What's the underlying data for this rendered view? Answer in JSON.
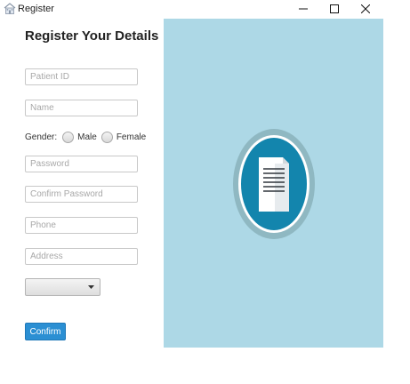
{
  "window": {
    "title": "Register",
    "icon": "hospital-icon",
    "controls": [
      "minimize-icon",
      "maximize-icon",
      "close-icon"
    ]
  },
  "form": {
    "heading": "Register Your Details",
    "patient_id_placeholder": "Patient ID",
    "name_placeholder": "Name",
    "gender": {
      "label": "Gender:",
      "options": [
        "Male",
        "Female"
      ]
    },
    "password_placeholder": "Password",
    "confirm_password_placeholder": "Confirm Password",
    "phone_placeholder": "Phone",
    "address_placeholder": "Address",
    "dropdown": {
      "selected": ""
    },
    "confirm_label": "Confirm"
  },
  "side_panel": {
    "illustration": "document-icon",
    "colors": {
      "background": "#add8e6",
      "ring_outer": "#8fb8c2",
      "ring_inner": "#ffffff",
      "disc": "#1385ad"
    }
  },
  "colors": {
    "button": "#2b8fd3",
    "field_border": "#c8c8c8"
  }
}
